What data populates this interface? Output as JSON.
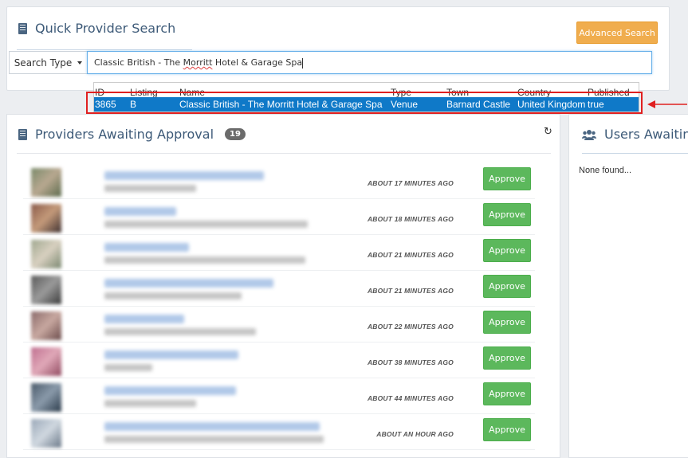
{
  "quick_search": {
    "title": "Quick Provider Search",
    "advanced_button": "Advanced Search",
    "search_type_label": "Search Type",
    "query_prefix": "Classic British - The ",
    "query_misspelled": "Morritt",
    "query_suffix": " Hotel & Garage Spa"
  },
  "dropdown": {
    "headers": {
      "id": "ID",
      "listing": "Listing",
      "name": "Name",
      "type": "Type",
      "town": "Town",
      "country": "Country",
      "published": "Published"
    },
    "result": {
      "id": "3865",
      "listing": "B",
      "name": "Classic British - The Morritt Hotel & Garage Spa",
      "type": "Venue",
      "town": "Barnard Castle",
      "country": "United Kingdom",
      "published": "true"
    }
  },
  "providers": {
    "title": "Providers Awaiting Approval",
    "count": "19",
    "approve_label": "Approve",
    "rows": [
      {
        "time": "ABOUT 17 MINUTES AGO"
      },
      {
        "time": "ABOUT 18 MINUTES AGO"
      },
      {
        "time": "ABOUT 21 MINUTES AGO"
      },
      {
        "time": "ABOUT 21 MINUTES AGO"
      },
      {
        "time": "ABOUT 22 MINUTES AGO"
      },
      {
        "time": "ABOUT 38 MINUTES AGO"
      },
      {
        "time": "ABOUT 44 MINUTES AGO"
      },
      {
        "time": "ABOUT AN HOUR AGO"
      }
    ]
  },
  "users": {
    "title": "Users Awaiting",
    "empty_text": "None found..."
  },
  "colors": {
    "accent_orange": "#f0ad4e",
    "approve_green": "#5cb85c",
    "highlight_blue": "#0f79c8",
    "annotation_red": "#e02020"
  }
}
